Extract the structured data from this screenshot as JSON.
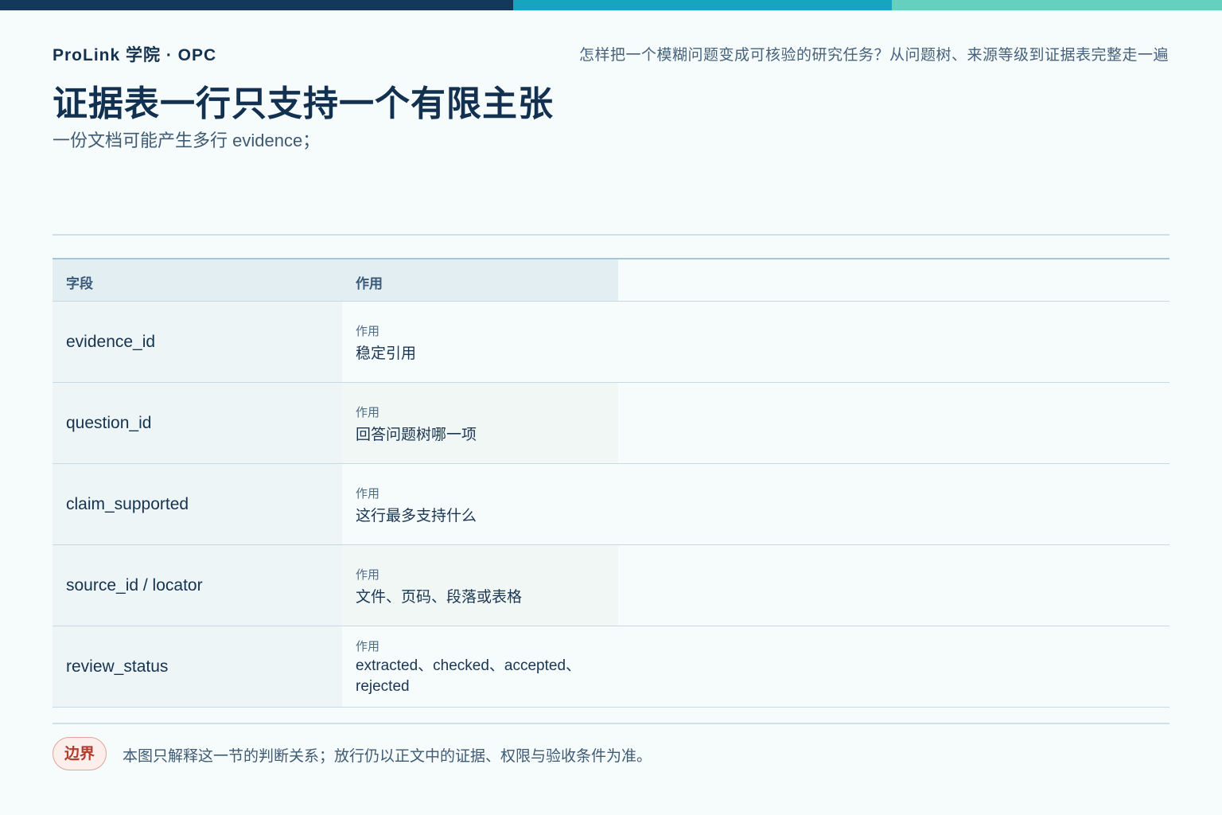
{
  "brand": "ProLink 学院 · OPC",
  "tagline": "怎样把一个模糊问题变成可核验的研究任务？从问题树、来源等级到证据表完整走一遍",
  "title": "证据表一行只支持一个有限主张",
  "subtitle": "一份文档可能产生多行 evidence；",
  "table": {
    "headers": [
      "字段",
      "作用"
    ],
    "rows": [
      {
        "field": "evidence_id",
        "role_label": "作用",
        "role": "稳定引用"
      },
      {
        "field": "question_id",
        "role_label": "作用",
        "role": "回答问题树哪一项"
      },
      {
        "field": "claim_supported",
        "role_label": "作用",
        "role": "这行最多支持什么"
      },
      {
        "field": "source_id / locator",
        "role_label": "作用",
        "role": "文件、页码、段落或表格"
      },
      {
        "field": "review_status",
        "role_label": "作用",
        "role": "extracted、checked、accepted、rejected"
      }
    ]
  },
  "footer": {
    "badge": "边界",
    "note": "本图只解释这一节的判断关系；放行仍以正文中的证据、权限与验收条件为准。"
  },
  "colors": {
    "bar_navy": "#12385a",
    "bar_teal": "#17a4be",
    "bar_mint": "#66d0be",
    "badge_red": "#b03c2e"
  }
}
